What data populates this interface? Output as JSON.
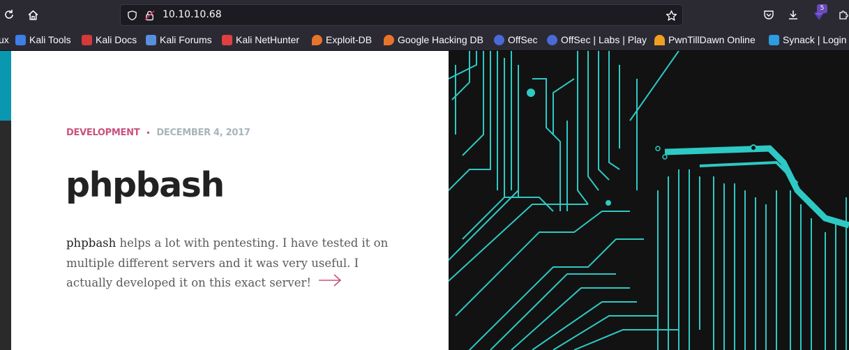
{
  "browser": {
    "url": "10.10.10.68",
    "extensions_badge": "5"
  },
  "bookmarks": [
    {
      "label": "ux",
      "color": "#2b2a33"
    },
    {
      "label": "Kali Tools",
      "color": "#3d7ee8"
    },
    {
      "label": "Kali Docs",
      "color": "#d33a3a"
    },
    {
      "label": "Kali Forums",
      "color": "#5a8ee0"
    },
    {
      "label": "Kali NetHunter",
      "color": "#e04040"
    },
    {
      "label": "Exploit-DB",
      "color": "#e8742b"
    },
    {
      "label": "Google Hacking DB",
      "color": "#e8742b"
    },
    {
      "label": "OffSec",
      "color": "#4a6ad8"
    },
    {
      "label": "OffSec | Labs | Play",
      "color": "#4a6ad8"
    },
    {
      "label": "PwnTillDawn Online",
      "color": "#f0a020"
    },
    {
      "label": "Synack | Login",
      "color": "#2b9de0"
    }
  ],
  "post": {
    "category": "DEVELOPMENT",
    "separator": "•",
    "date": "DECEMBER 4, 2017",
    "title": "phpbash",
    "excerpt_lead": "phpbash",
    "excerpt_rest": " helps a lot with pentesting. I have tested it on multiple different servers and it was very useful. I actually developed it on this exact server!"
  },
  "colors": {
    "accent": "#c9527e",
    "circuit": "#2ec9c4",
    "edge": "#0a97b0"
  },
  "icons": [
    "reload-icon",
    "home-icon",
    "shield-icon",
    "lock-icon",
    "bookmark-star-icon",
    "pocket-icon",
    "download-icon",
    "extension-icon",
    "puzzle-icon",
    "arrow-right-icon"
  ]
}
